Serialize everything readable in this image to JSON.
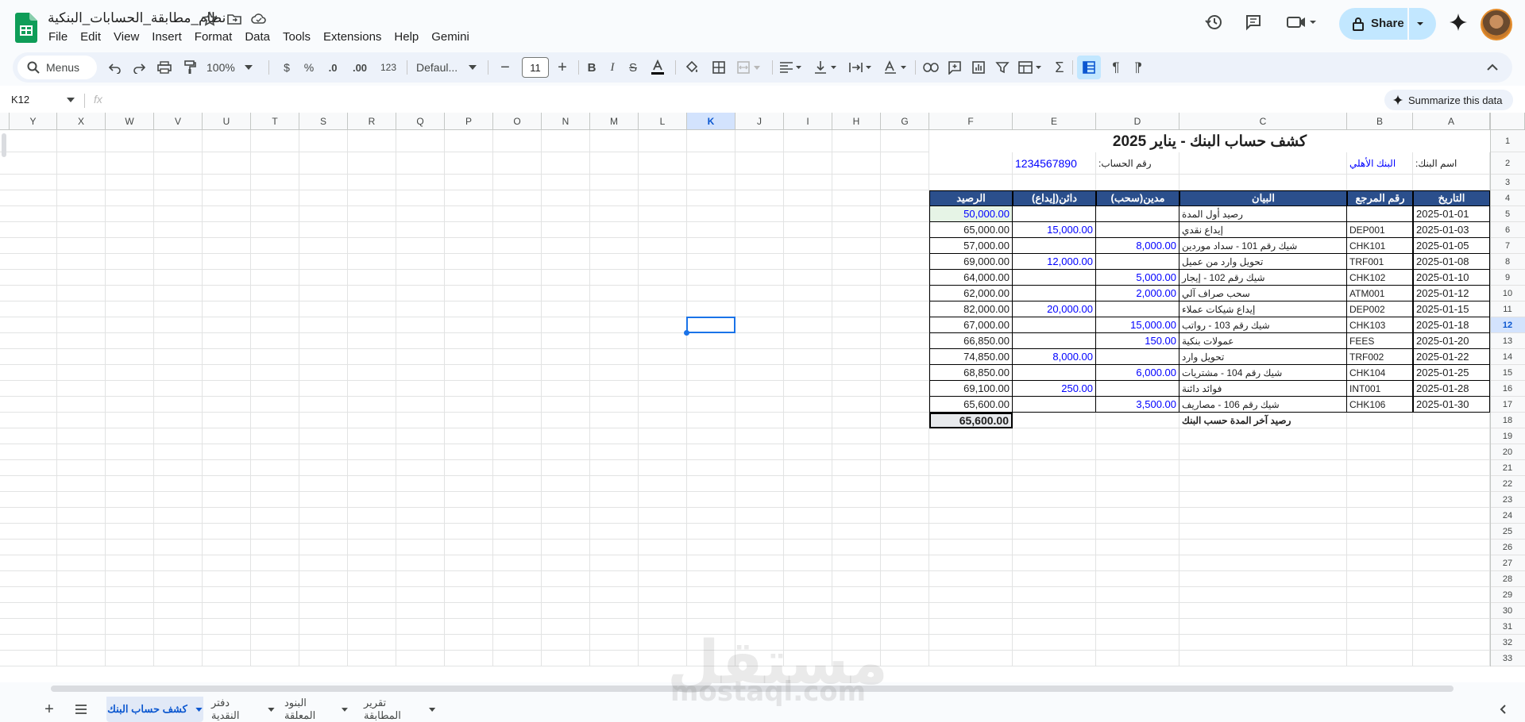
{
  "doc": {
    "title": "نظام_مطابقة_الحسابات_البنكية",
    "menu": [
      "File",
      "Edit",
      "View",
      "Insert",
      "Format",
      "Data",
      "Tools",
      "Extensions",
      "Help",
      "Gemini"
    ]
  },
  "header": {
    "share_label": "Share"
  },
  "toolbar": {
    "menus_label": "Menus",
    "zoom": "100%",
    "font": "Defaul...",
    "font_size": "11",
    "currency": "$",
    "percent": "%",
    "dec_less": ".0",
    "dec_more": ".00",
    "number_format": "123"
  },
  "formula_bar": {
    "cell_ref": "K12",
    "fx": "fx",
    "summarize": "Summarize this data"
  },
  "columns": [
    "Y",
    "X",
    "W",
    "V",
    "U",
    "T",
    "S",
    "R",
    "Q",
    "P",
    "O",
    "N",
    "M",
    "L",
    "K",
    "J",
    "I",
    "H",
    "G",
    "F",
    "E",
    "D",
    "C",
    "B",
    "A"
  ],
  "selected_column": "K",
  "selected_row": 12,
  "sheet": {
    "title": "كشف حساب البنك - يناير 2025",
    "bank_label": "اسم البنك:",
    "bank_name": "البنك الأهلي",
    "account_label": "رقم الحساب:",
    "account_number": "1234567890",
    "headers": {
      "date": "التاريخ",
      "ref": "رقم المرجع",
      "desc": "البيان",
      "debit": "مدين(سحب)",
      "credit": "دائن(إيداع)",
      "balance": "الرصيد"
    },
    "rows": [
      {
        "date": "2025-01-01",
        "ref": "",
        "desc": "رصيد أول المدة",
        "debit": "",
        "credit": "",
        "balance": "50,000.00"
      },
      {
        "date": "2025-01-03",
        "ref": "DEP001",
        "desc": "إيداع نقدي",
        "debit": "",
        "credit": "15,000.00",
        "balance": "65,000.00"
      },
      {
        "date": "2025-01-05",
        "ref": "CHK101",
        "desc": "شيك رقم 101 - سداد موردين",
        "debit": "8,000.00",
        "credit": "",
        "balance": "57,000.00"
      },
      {
        "date": "2025-01-08",
        "ref": "TRF001",
        "desc": "تحويل وارد من عميل",
        "debit": "",
        "credit": "12,000.00",
        "balance": "69,000.00"
      },
      {
        "date": "2025-01-10",
        "ref": "CHK102",
        "desc": "شيك رقم 102 - إيجار",
        "debit": "5,000.00",
        "credit": "",
        "balance": "64,000.00"
      },
      {
        "date": "2025-01-12",
        "ref": "ATM001",
        "desc": "سحب صراف آلي",
        "debit": "2,000.00",
        "credit": "",
        "balance": "62,000.00"
      },
      {
        "date": "2025-01-15",
        "ref": "DEP002",
        "desc": "إيداع شيكات عملاء",
        "debit": "",
        "credit": "20,000.00",
        "balance": "82,000.00"
      },
      {
        "date": "2025-01-18",
        "ref": "CHK103",
        "desc": "شيك رقم 103 - رواتب",
        "debit": "15,000.00",
        "credit": "",
        "balance": "67,000.00"
      },
      {
        "date": "2025-01-20",
        "ref": "FEES",
        "desc": "عمولات بنكية",
        "debit": "150.00",
        "credit": "",
        "balance": "66,850.00"
      },
      {
        "date": "2025-01-22",
        "ref": "TRF002",
        "desc": "تحويل وارد",
        "debit": "",
        "credit": "8,000.00",
        "balance": "74,850.00"
      },
      {
        "date": "2025-01-25",
        "ref": "CHK104",
        "desc": "شيك رقم 104 - مشتريات",
        "debit": "6,000.00",
        "credit": "",
        "balance": "68,850.00"
      },
      {
        "date": "2025-01-28",
        "ref": "INT001",
        "desc": "فوائد دائنة",
        "debit": "",
        "credit": "250.00",
        "balance": "69,100.00"
      },
      {
        "date": "2025-01-30",
        "ref": "CHK106",
        "desc": "شيك رقم 106 - مصاريف",
        "debit": "3,500.00",
        "credit": "",
        "balance": "65,600.00"
      }
    ],
    "closing_label": "رصيد آخر المدة حسب البنك",
    "closing_balance": "65,600.00"
  },
  "row_numbers": [
    "1",
    "2",
    "3",
    "4",
    "5",
    "6",
    "7",
    "8",
    "9",
    "10",
    "11",
    "12",
    "13",
    "14",
    "15",
    "16",
    "17",
    "18",
    "19",
    "20",
    "21",
    "22",
    "23",
    "24",
    "25",
    "26",
    "27",
    "28",
    "29",
    "30",
    "31",
    "32",
    "33"
  ],
  "tabs": [
    {
      "label": "كشف حساب البنك",
      "active": true
    },
    {
      "label": "دفتر النقدية",
      "active": false
    },
    {
      "label": "البنود المعلقة",
      "active": false
    },
    {
      "label": "تقرير المطابقة",
      "active": false
    }
  ],
  "watermark": {
    "arabic": "مستقل",
    "latin": "mostaql.com"
  },
  "colors": {
    "header_fill": "#2b4f8c",
    "value_blue": "#0000ff",
    "accent": "#1a73e8",
    "opening_fill": "#e6f4e6"
  }
}
